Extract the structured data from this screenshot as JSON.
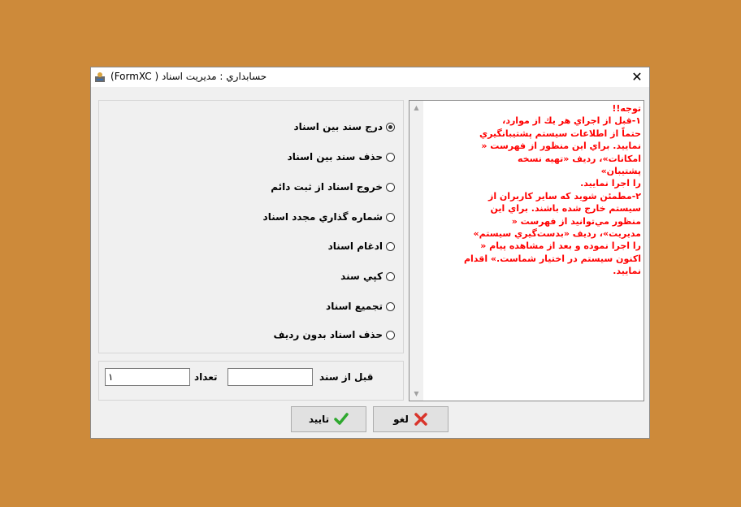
{
  "window": {
    "title": "حسابداري : مديريت اسناد ( FormXC)",
    "close_glyph": "✕"
  },
  "notes": {
    "text": "توجه!!\n۱-قبل از اجراي هر يك از موارد،\nحتماً از اطلاعات سيستم پشتيبانگيري\nنماييد. براي اين منظور از فهرست «\nامكانات»، رديف «تهيه نسخه\nپشتيبان»\nرا اجرا نماييد.\n۲-مطمئن شويد كه ساير كاربران از\nسيستم خارج شده باشند. براي اين\nمنظور مي‌توانيد از فهرست «\nمديريت»، رديف «بدست‌گيري سيستم»\nرا اجرا نموده و بعد از مشاهده پيام «\nاكنون سيستم در اختيار شماست.» اقدام\nنماييد."
  },
  "options": [
    {
      "label": "درج سند بين اسناد",
      "checked": true
    },
    {
      "label": "حذف سند بين اسناد",
      "checked": false
    },
    {
      "label": "خروج اسناد از ثبت دائم",
      "checked": false
    },
    {
      "label": "شماره گذاري مجدد اسناد",
      "checked": false
    },
    {
      "label": "ادغام اسناد",
      "checked": false
    },
    {
      "label": "كپي سند",
      "checked": false
    },
    {
      "label": "تجميع اسناد",
      "checked": false
    },
    {
      "label": "حذف اسناد بدون رديف",
      "checked": false
    }
  ],
  "fields": {
    "before_doc_label": "قبل از سند",
    "before_doc_value": "",
    "count_label": "تعداد",
    "count_value": "۱"
  },
  "buttons": {
    "cancel_label": "لغو",
    "confirm_label": "تاييد"
  },
  "colors": {
    "background": "#CD8A3A",
    "notes_text": "#FF0000",
    "confirm_icon": "#2EA82E",
    "cancel_icon": "#D9342B"
  }
}
